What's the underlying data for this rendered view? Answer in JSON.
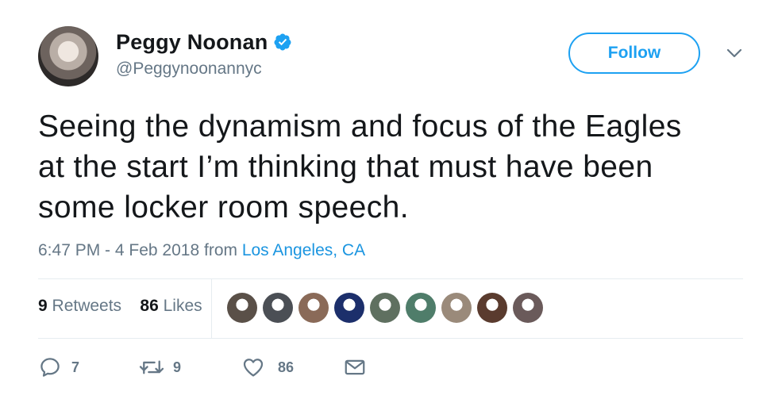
{
  "author": {
    "display_name": "Peggy Noonan",
    "handle": "@Peggynoonannyc",
    "verified": true,
    "avatar_icon": "profile-photo-avatar"
  },
  "header": {
    "follow_label": "Follow",
    "menu_icon": "chevron-down-icon"
  },
  "tweet": {
    "lines": [
      "Seeing the dynamism and focus of the Eagles",
      "at the start I’m thinking that must have been",
      "some locker room speech."
    ]
  },
  "meta": {
    "time": "6:47 PM",
    "separator": " - ",
    "date": "4 Feb 2018",
    "from_label": " from ",
    "location": "Los Angeles, CA"
  },
  "stats": {
    "retweets_count": "9",
    "retweets_label": " Retweets",
    "likes_count": "86",
    "likes_label": " Likes",
    "liker_avatars": [
      {
        "name": "liker-1",
        "color": "#5a5048"
      },
      {
        "name": "liker-2",
        "color": "#4b4f55"
      },
      {
        "name": "liker-3",
        "color": "#8a6a58"
      },
      {
        "name": "liker-4",
        "color": "#1c2f6b"
      },
      {
        "name": "liker-5",
        "color": "#5f7060"
      },
      {
        "name": "liker-6",
        "color": "#4f7d6a"
      },
      {
        "name": "liker-7",
        "color": "#9a8a7a"
      },
      {
        "name": "liker-8",
        "color": "#5a3b2e"
      },
      {
        "name": "liker-9",
        "color": "#6a5a5a"
      }
    ]
  },
  "actions": {
    "reply_count": "7",
    "retweet_count": "9",
    "like_count": "86"
  },
  "colors": {
    "accent": "#1da1f2",
    "link": "#1b95e0",
    "secondary_text": "#657786",
    "divider": "#e6ecf0"
  }
}
